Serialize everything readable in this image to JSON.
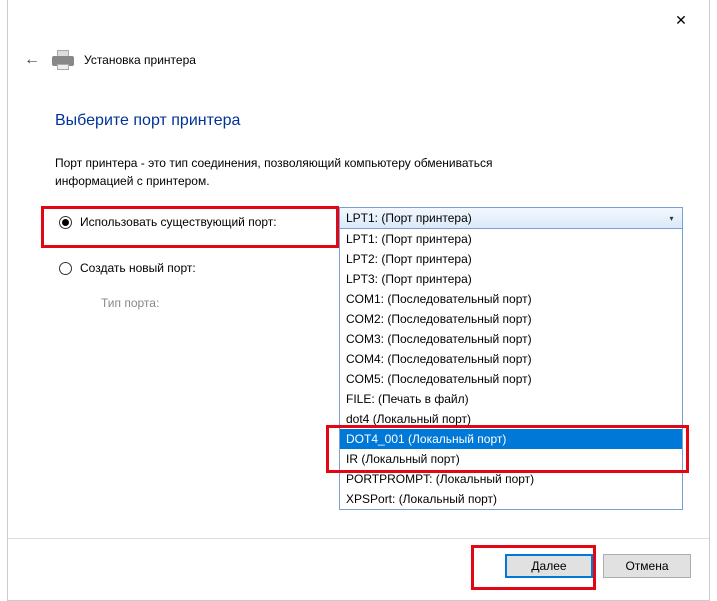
{
  "header": {
    "title": "Установка принтера"
  },
  "heading": "Выберите порт принтера",
  "description_l1": "Порт принтера - это тип соединения, позволяющий компьютеру обмениваться",
  "description_l2": "информацией с принтером.",
  "options": {
    "use_existing_label": "Использовать существующий порт:",
    "create_new_label": "Создать новый порт:",
    "port_type_label": "Тип порта:"
  },
  "dropdown": {
    "selected": "LPT1: (Порт принтера)",
    "items": [
      "LPT1: (Порт принтера)",
      "LPT2: (Порт принтера)",
      "LPT3: (Порт принтера)",
      "COM1: (Последовательный порт)",
      "COM2: (Последовательный порт)",
      "COM3: (Последовательный порт)",
      "COM4: (Последовательный порт)",
      "COM5: (Последовательный порт)",
      "FILE: (Печать в файл)",
      "dot4 (Локальный порт)",
      "DOT4_001 (Локальный порт)",
      "IR (Локальный порт)",
      "PORTPROMPT: (Локальный порт)",
      "XPSPort: (Локальный порт)"
    ],
    "highlighted_index": 10
  },
  "footer": {
    "next": "Далее",
    "cancel": "Отмена"
  }
}
